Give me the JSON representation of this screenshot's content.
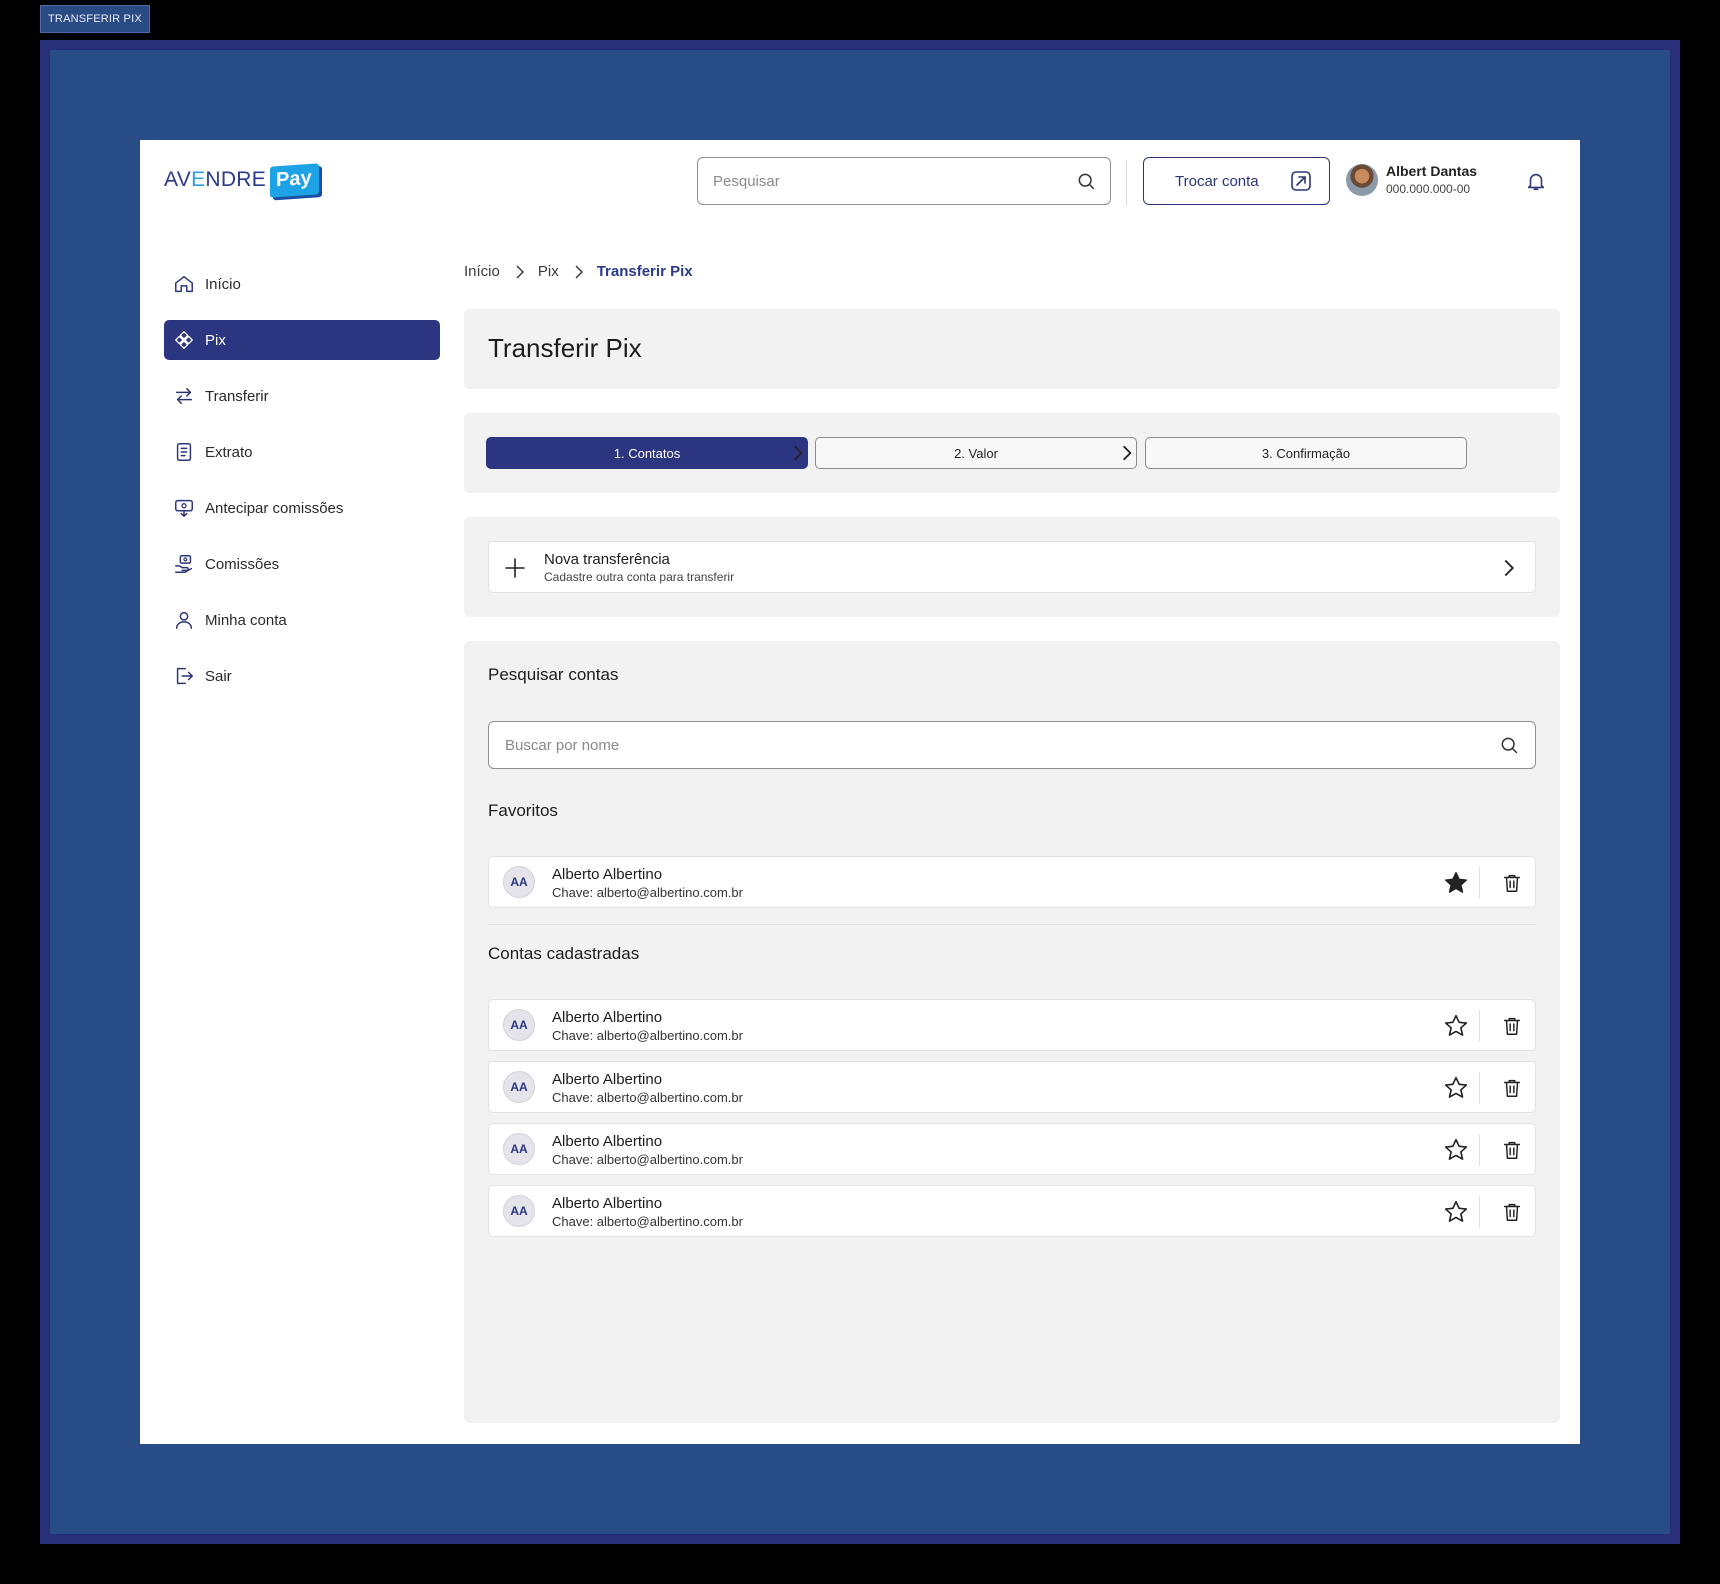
{
  "frame_tag": "TRANSFERIR PIX",
  "logo": {
    "text_pre": "AV",
    "text_e": "E",
    "text_post": "NDRE",
    "pay": "Pay"
  },
  "header": {
    "search_placeholder": "Pesquisar",
    "switch_account": "Trocar conta",
    "user_name": "Albert Dantas",
    "user_id": "000.000.000-00"
  },
  "sidebar": {
    "items": [
      {
        "label": "Início",
        "icon": "home-icon"
      },
      {
        "label": "Pix",
        "icon": "pix-icon",
        "active": true
      },
      {
        "label": "Transferir",
        "icon": "transfer-arrows-icon"
      },
      {
        "label": "Extrato",
        "icon": "statement-icon"
      },
      {
        "label": "Antecipar comissões",
        "icon": "advance-money-icon"
      },
      {
        "label": "Comissões",
        "icon": "commission-icon"
      },
      {
        "label": "Minha conta",
        "icon": "user-icon"
      },
      {
        "label": "Sair",
        "icon": "logout-icon"
      }
    ]
  },
  "breadcrumb": {
    "items": [
      "Início",
      "Pix"
    ],
    "current": "Transferir Pix"
  },
  "page_title": "Transferir Pix",
  "steps": [
    "1. Contatos",
    "2. Valor",
    "3. Confirmação"
  ],
  "active_step": 0,
  "new_transfer": {
    "title": "Nova transferência",
    "subtitle": "Cadastre outra conta para transferir"
  },
  "accounts": {
    "search_title": "Pesquisar contas",
    "search_placeholder": "Buscar por nome",
    "favorites_title": "Favoritos",
    "favorites": [
      {
        "initials": "AA",
        "name": "Alberto Albertino",
        "key": "Chave: alberto@albertino.com.br",
        "favorite": true
      }
    ],
    "registered_title": "Contas cadastradas",
    "registered": [
      {
        "initials": "AA",
        "name": "Alberto Albertino",
        "key": "Chave: alberto@albertino.com.br",
        "favorite": false
      },
      {
        "initials": "AA",
        "name": "Alberto Albertino",
        "key": "Chave: alberto@albertino.com.br",
        "favorite": false
      },
      {
        "initials": "AA",
        "name": "Alberto Albertino",
        "key": "Chave: alberto@albertino.com.br",
        "favorite": false
      },
      {
        "initials": "AA",
        "name": "Alberto Albertino",
        "key": "Chave: alberto@albertino.com.br",
        "favorite": false
      }
    ]
  },
  "colors": {
    "primary": "#2b3580",
    "brand_blue": "#1ea2e6",
    "panel": "#f2f2f2",
    "frame_bg": "#284d86"
  }
}
